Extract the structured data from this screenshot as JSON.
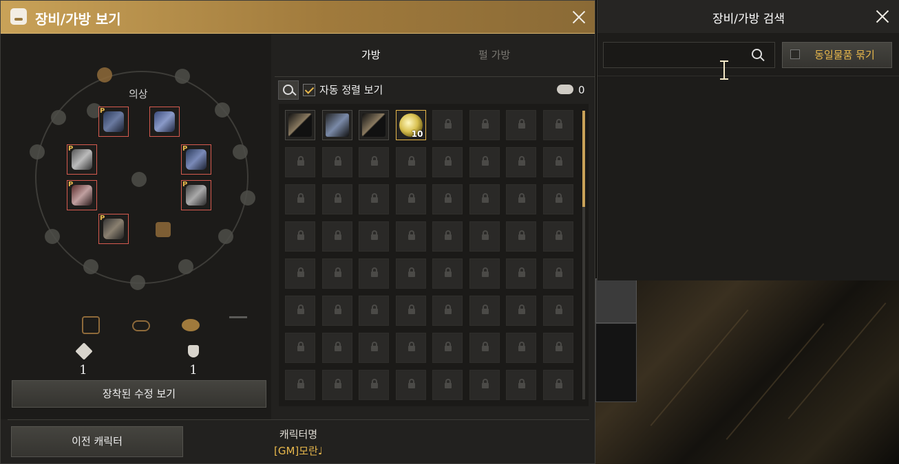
{
  "main_window": {
    "title": "장비/가방 보기"
  },
  "character": {
    "costume_label": "의상",
    "stat_sword": "1",
    "stat_shield": "1",
    "view_crystals_button": "장착된 수정 보기",
    "prev_character_button": "이전 캐릭터",
    "name_label": "캐릭터명",
    "name_value": "[GM]모란♩"
  },
  "bag": {
    "tabs": [
      {
        "label": "가방",
        "active": true
      },
      {
        "label": "펄 가방",
        "active": false
      }
    ],
    "auto_sort_label": "자동 정렬 보기",
    "auto_sort_checked": true,
    "silver_amount": "0",
    "items": [
      {
        "slot": 1,
        "icon": "bow-icon"
      },
      {
        "slot": 2,
        "icon": "crossbow-icon"
      },
      {
        "slot": 3,
        "icon": "bow-icon"
      },
      {
        "slot": 4,
        "icon": "gold-orb-icon",
        "count": "10"
      }
    ]
  },
  "search_window": {
    "title": "장비/가방 검색",
    "input_value": "",
    "group_same_items_label": "동일물품 묶기"
  },
  "colors": {
    "accent": "#c9a258",
    "slot_border": "#d75b4f",
    "gold": "#e8b84c"
  }
}
